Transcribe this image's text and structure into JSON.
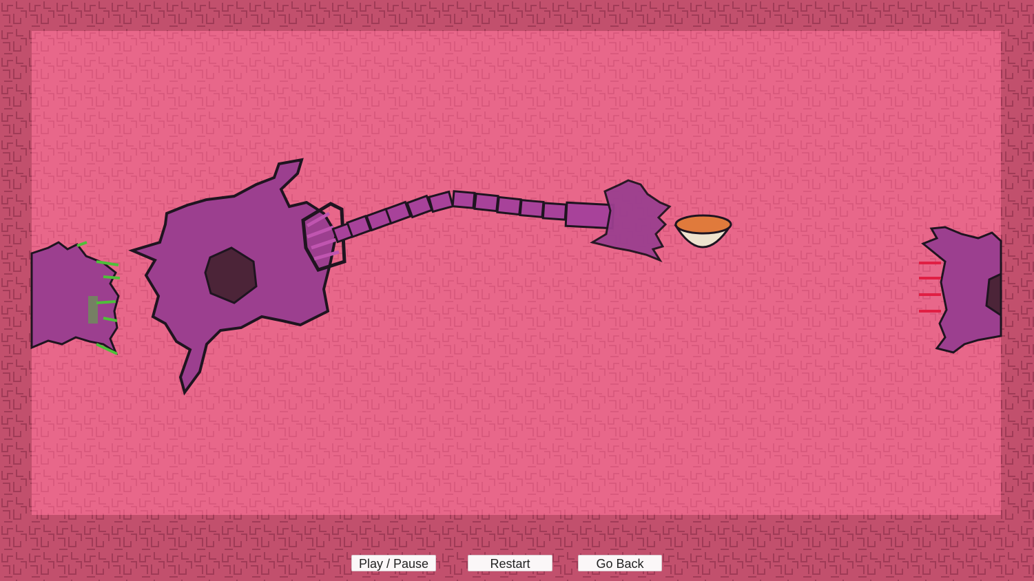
{
  "colors": {
    "wall": "#c2506d",
    "floor": "#e8678a",
    "cell": "#9c3f8f",
    "cell_dark": "#4c2438",
    "outline": "#1f1420",
    "infected_green": "#4fbf3a",
    "bowl_soup": "#e07a3c"
  },
  "controls": {
    "play_pause": "Play / Pause",
    "restart": "Restart",
    "go_back": "Go Back"
  }
}
